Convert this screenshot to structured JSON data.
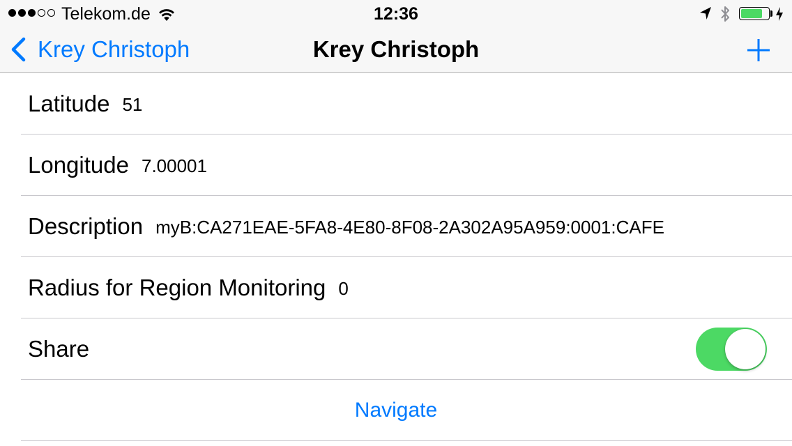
{
  "status_bar": {
    "signal_strength": {
      "filled": 3,
      "total": 5
    },
    "carrier": "Telekom.de",
    "time": "12:36",
    "icons": [
      "signal-dots-icon",
      "wifi-icon",
      "location-arrow-icon",
      "bluetooth-icon",
      "battery-icon",
      "charging-bolt-icon"
    ],
    "battery_level": 0.8,
    "battery_color": "#4cd964"
  },
  "nav_bar": {
    "back_label": "Krey Christoph",
    "title": "Krey Christoph",
    "add_icon": "plus-icon",
    "accent_color": "#007aff"
  },
  "fields": {
    "latitude": {
      "label": "Latitude",
      "value": "51"
    },
    "longitude": {
      "label": "Longitude",
      "value": "7.00001"
    },
    "description": {
      "label": "Description",
      "value": "myB:CA271EAE-5FA8-4E80-8F08-2A302A95A959:0001:CAFE"
    },
    "radius": {
      "label": "Radius for Region Monitoring",
      "value": "0"
    },
    "share": {
      "label": "Share",
      "enabled": true,
      "toggle_color": "#4cd964"
    }
  },
  "actions": {
    "navigate_label": "Navigate"
  }
}
